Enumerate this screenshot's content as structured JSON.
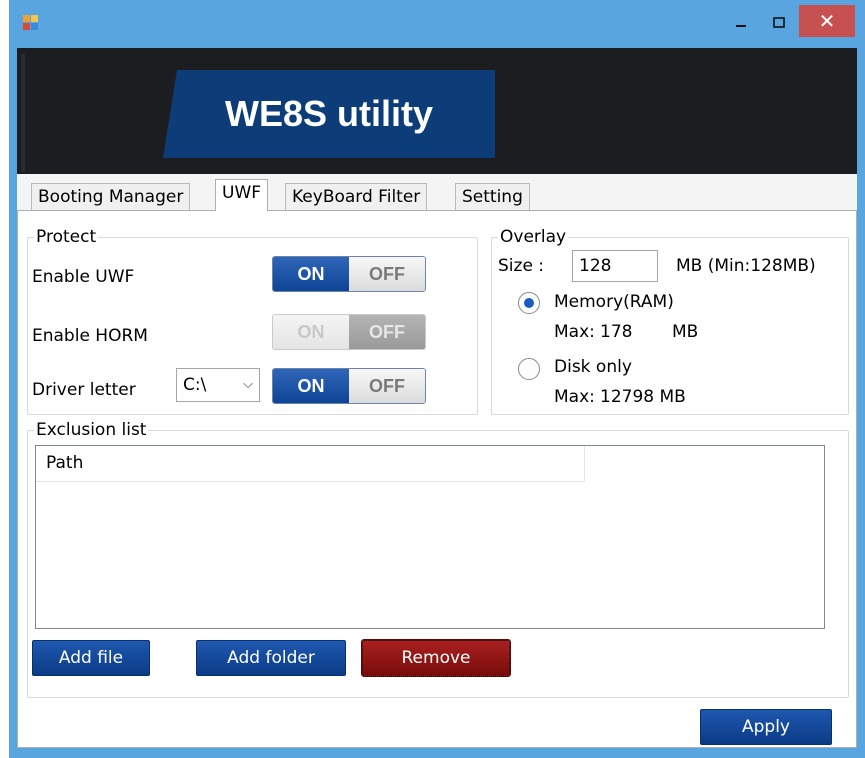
{
  "window": {
    "banner_title": "WE8S utility",
    "close_glyph": "✕",
    "icons": [
      "app-icon",
      "minimize-icon",
      "maximize-icon",
      "close-icon"
    ]
  },
  "tabs": [
    {
      "label": "Booting Manager",
      "active": false
    },
    {
      "label": "UWF",
      "active": true
    },
    {
      "label": "KeyBoard Filter",
      "active": false
    },
    {
      "label": "Setting",
      "active": false
    }
  ],
  "protect": {
    "legend": "Protect",
    "enable_uwf": {
      "label": "Enable UWF",
      "on": "ON",
      "off": "OFF",
      "state": "on"
    },
    "enable_horm": {
      "label": "Enable HORM",
      "on": "ON",
      "off": "OFF",
      "state": "off",
      "disabled": true
    },
    "driver_letter": {
      "label": "Driver letter",
      "value": "C:\\",
      "on": "ON",
      "off": "OFF",
      "state": "on"
    }
  },
  "overlay": {
    "legend": "Overlay",
    "size_label": "Size :",
    "size_value": "128",
    "size_unit": "MB  (Min:128MB)",
    "memory": {
      "label": "Memory(RAM)",
      "max_label": "Max:",
      "max_value": "178",
      "max_unit": "MB",
      "selected": true
    },
    "disk": {
      "label": "Disk only",
      "max_label": "Max:",
      "max_value": "12798 MB",
      "selected": false
    }
  },
  "exclusion": {
    "legend": "Exclusion list",
    "column_path": "Path",
    "rows": []
  },
  "buttons": {
    "add_file": "Add file",
    "add_folder": "Add folder",
    "remove": "Remove",
    "apply": "Apply"
  },
  "colors": {
    "title_bar": "#59a5e0",
    "banner_bg": "#1c1d21",
    "banner_title_bg": "#0c3d78",
    "accent_blue": "#0f4595",
    "remove_red": "#8a1414",
    "close_red": "#c75050"
  }
}
